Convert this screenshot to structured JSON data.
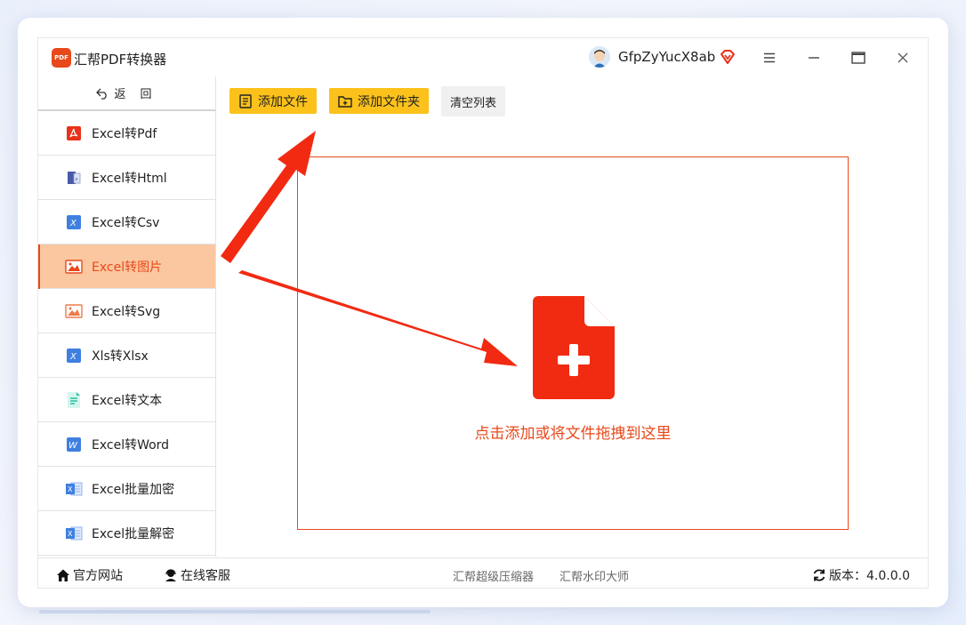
{
  "app": {
    "title": "汇帮PDF转换器",
    "logo_text": "PDF",
    "username": "GfpZyYucX8ab"
  },
  "colors": {
    "accent": "#e8491b",
    "active_bg": "#fbc7a0",
    "button_yellow": "#fcc21b"
  },
  "sidebar": {
    "back_label": "返 回",
    "items": [
      {
        "label": "Excel转Pdf",
        "icon": "pdf-icon"
      },
      {
        "label": "Excel转Html",
        "icon": "html-icon"
      },
      {
        "label": "Excel转Csv",
        "icon": "csv-icon"
      },
      {
        "label": "Excel转图片",
        "icon": "image-icon",
        "active": true
      },
      {
        "label": "Excel转Svg",
        "icon": "svg-image-icon"
      },
      {
        "label": "Xls转Xlsx",
        "icon": "xlsx-icon"
      },
      {
        "label": "Excel转文本",
        "icon": "text-file-icon"
      },
      {
        "label": "Excel转Word",
        "icon": "word-icon"
      },
      {
        "label": "Excel批量加密",
        "icon": "excel-lock-icon"
      },
      {
        "label": "Excel批量解密",
        "icon": "excel-unlock-icon"
      }
    ]
  },
  "toolbar": {
    "add_file": "添加文件",
    "add_folder": "添加文件夹",
    "clear_list": "清空列表"
  },
  "dropzone": {
    "text": "点击添加或将文件拖拽到这里"
  },
  "footer": {
    "website": "官方网站",
    "support": "在线客服",
    "link1": "汇帮超级压缩器",
    "link2": "汇帮水印大师",
    "version": "版本：4.0.0.0"
  }
}
